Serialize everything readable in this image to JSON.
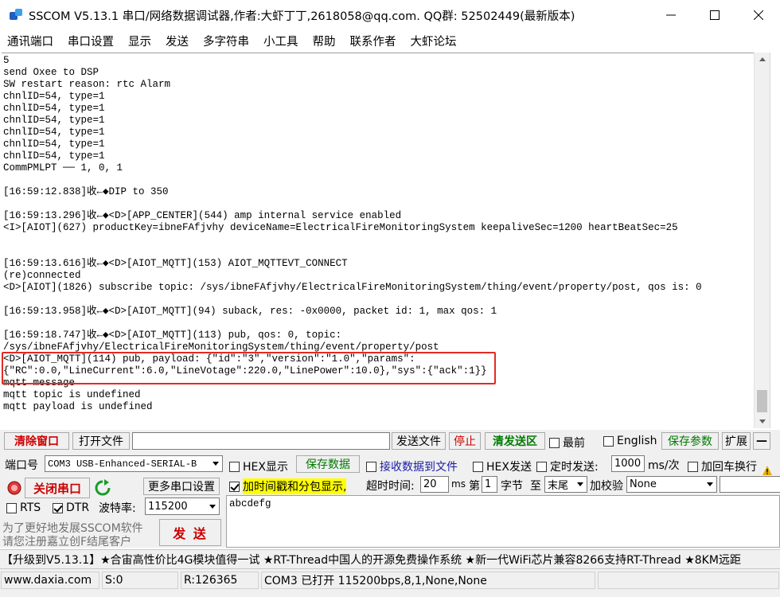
{
  "window": {
    "title": "SSCOM V5.13.1 串口/网络数据调试器,作者:大虾丁丁,2618058@qq.com. QQ群: 52502449(最新版本)"
  },
  "menu": [
    "通讯端口",
    "串口设置",
    "显示",
    "发送",
    "多字符串",
    "小工具",
    "帮助",
    "联系作者",
    "大虾论坛"
  ],
  "output": {
    "lines": [
      "5",
      "send Oxee to DSP",
      "SW restart reason: rtc Alarm",
      "chnlID=54, type=1",
      "chnlID=54, type=1",
      "chnlID=54, type=1",
      "chnlID=54, type=1",
      "chnlID=54, type=1",
      "chnlID=54, type=1",
      "CommPMLPT ── 1, 0, 1",
      "",
      "[16:59:12.838]收←◆DIP to 350",
      "",
      "[16:59:13.296]收←◆<D>[APP_CENTER](544) amp internal service enabled",
      "<I>[AIOT](627) productKey=ibneFAfjvhy deviceName=ElectricalFireMonitoringSystem keepaliveSec=1200 heartBeatSec=25",
      "",
      "",
      "[16:59:13.616]收←◆<D>[AIOT_MQTT](153) AIOT_MQTTEVT_CONNECT",
      "(re)connected",
      "<D>[AIOT](1826) subscribe topic: /sys/ibneFAfjvhy/ElectricalFireMonitoringSystem/thing/event/property/post, qos is: 0",
      "",
      "[16:59:13.958]收←◆<D>[AIOT_MQTT](94) suback, res: -0x0000, packet id: 1, max qos: 1",
      "",
      "[16:59:18.747]收←◆<D>[AIOT_MQTT](113) pub, qos: 0, topic:",
      "/sys/ibneFAfjvhy/ElectricalFireMonitoringSystem/thing/event/property/post",
      "<D>[AIOT_MQTT](114) pub, payload: {\"id\":\"3\",\"version\":\"1.0\",\"params\":",
      "{\"RC\":0.0,\"LineCurrent\":6.0,\"LineVotage\":220.0,\"LinePower\":10.0},\"sys\":{\"ack\":1}}",
      "mqtt message",
      "mqtt topic is undefined",
      "mqtt payload is undefined"
    ]
  },
  "toolbar": {
    "clear_window": "清除窗口",
    "open_file": "打开文件",
    "file_path": "",
    "send_file": "发送文件",
    "stop": "停止",
    "clear_send_area": "清发送区",
    "topmost": "最前",
    "english": "English",
    "save_params": "保存参数",
    "expand": "扩展",
    "collapse": "—"
  },
  "port": {
    "port_label": "端口号",
    "port_value": "COM3 USB-Enhanced-SERIAL-B",
    "hex_display": "HEX显示",
    "save_data": "保存数据",
    "save_to_file": "接收数据到文件",
    "hex_send": "HEX发送",
    "timed_send": "定时发送:",
    "interval": "1000",
    "interval_unit": "ms/次",
    "add_crlf": "加回车换行",
    "close_port": "关闭串口",
    "more_settings": "更多串口设置",
    "add_timestamp": "加时间戳和分包显示,",
    "timeout_label": "超时时间:",
    "timeout_value": "20",
    "timeout_unit": "ms",
    "page_label": "第",
    "page_value": "1",
    "byte_label": "字节",
    "to_label": "至",
    "to_value": "末尾",
    "checksum_label": "加校验",
    "checksum_value": "None",
    "rts": "RTS",
    "dtr": "DTR",
    "baud_label": "波特率:",
    "baud_value": "115200",
    "promo_line1": "为了更好地发展SSCOM软件",
    "promo_line2": "请您注册嘉立创F结尾客户",
    "send_button": "发 送",
    "send_text": "abcdefg"
  },
  "marquee": "【升级到V5.13.1】★合宙高性价比4G模块值得一试 ★RT-Thread中国人的开源免费操作系统 ★新一代WiFi芯片兼容8266支持RT-Thread ★8KM远距",
  "status": {
    "website": "www.daxia.com",
    "sent": "S:0",
    "received": "R:126365",
    "port_status": "COM3 已打开  115200bps,8,1,None,None"
  },
  "colors": {
    "highlight_border": "#e32b22",
    "red_text": "#cc0000",
    "green_text": "#007a00",
    "timestamp_highlight": "#ffff00"
  }
}
